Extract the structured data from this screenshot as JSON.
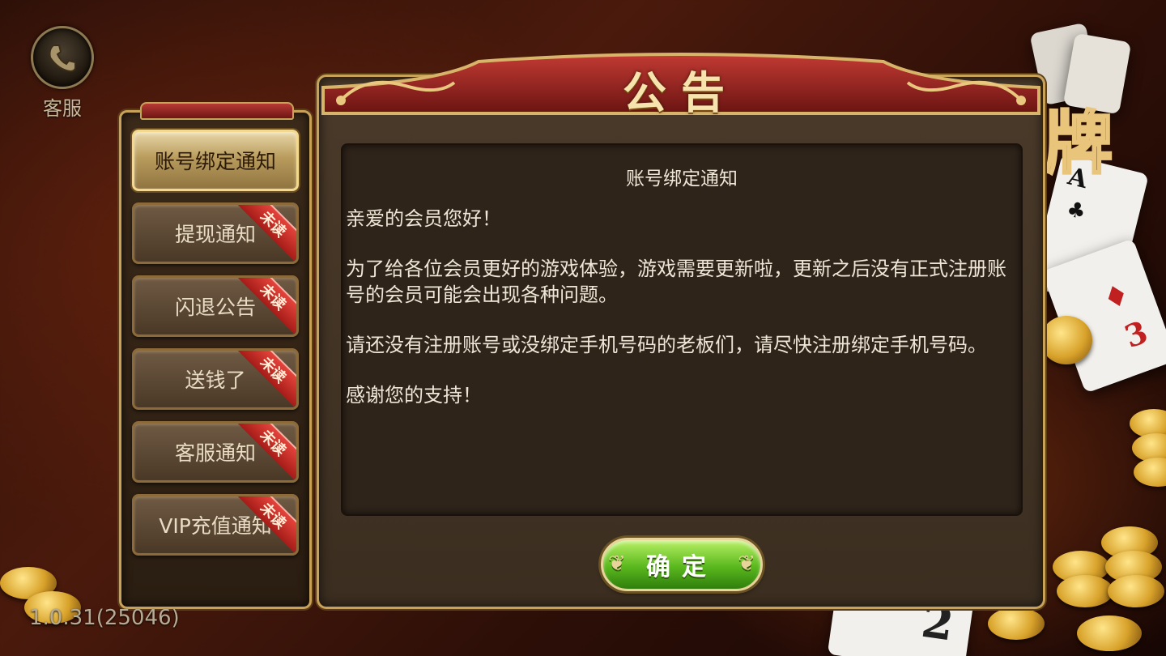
{
  "service": {
    "label": "客服",
    "icon": "phone-icon"
  },
  "title": "公告",
  "tabs": [
    {
      "label": "账号绑定通知",
      "unread": "",
      "active": true
    },
    {
      "label": "提现通知",
      "unread": "未读",
      "active": false
    },
    {
      "label": "闪退公告",
      "unread": "未读",
      "active": false
    },
    {
      "label": "送钱了",
      "unread": "未读",
      "active": false
    },
    {
      "label": "客服通知",
      "unread": "未读",
      "active": false
    },
    {
      "label": "VIP充值通知",
      "unread": "未读",
      "active": false
    }
  ],
  "notice": {
    "title": "账号绑定通知",
    "paragraphs": [
      "亲爱的会员您好！",
      "为了给各位会员更好的游戏体验，游戏需要更新啦，更新之后没有正式注册账号的会员可能会出现各种问题。",
      "请还没有注册账号或没绑定手机号码的老板们，请尽快注册绑定手机号码。",
      "感谢您的支持！"
    ]
  },
  "confirm_label": "确定",
  "version": "1.0.31(25046)",
  "colors": {
    "gold": "#c9a25a",
    "ribbon": "#e4433b",
    "confirm": "#5ab81e",
    "banner": "#8a1c1a"
  }
}
